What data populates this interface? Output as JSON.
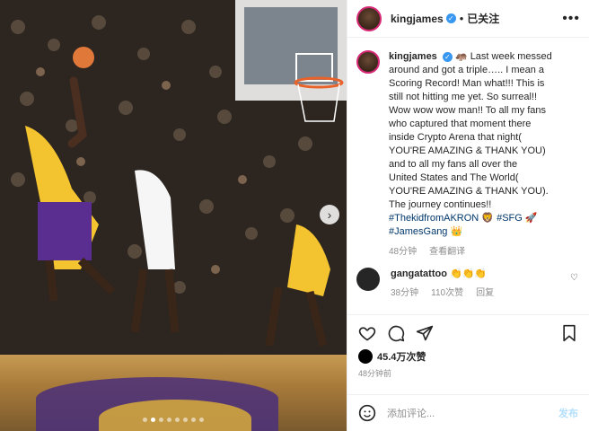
{
  "post": {
    "username": "kingjames",
    "follow_label": "已关注",
    "more_label": "•••",
    "caption_username": "kingjames",
    "caption_lines": [
      "🦛 Last week messed",
      "around and got a triple….. I mean a",
      "Scoring Record! Man what!!! This is",
      "still not hitting me yet. So surreal!!",
      "Wow wow wow man!! To all my fans",
      "who captured that moment there",
      "inside Crypto Arena that night(",
      "YOU'RE AMAZING & THANK YOU)",
      "and to all my fans all over the",
      "United States and The World(",
      "YOU'RE AMAZING & THANK YOU).",
      "The journey continues!!"
    ],
    "hashtags": [
      "#ThekidfromAKRON 🦁",
      "#SFG 🚀",
      "#JamesGang 👑"
    ],
    "caption_time": "48分钟",
    "translate_label": "查看翻译",
    "likes": "45.4万次赞",
    "posted_time": "48分钟前",
    "add_comment_placeholder": "添加评论...",
    "post_button": "发布"
  },
  "comment": {
    "username": "gangatattoo",
    "text": "👏👏👏",
    "time": "38分钟",
    "likes": "110次赞",
    "reply_label": "回复"
  },
  "colors": {
    "accent": "#3897f0",
    "text": "#262626",
    "muted": "#8e8e8e",
    "border": "#efefef"
  },
  "carousel": {
    "index": 2,
    "count": 8
  }
}
